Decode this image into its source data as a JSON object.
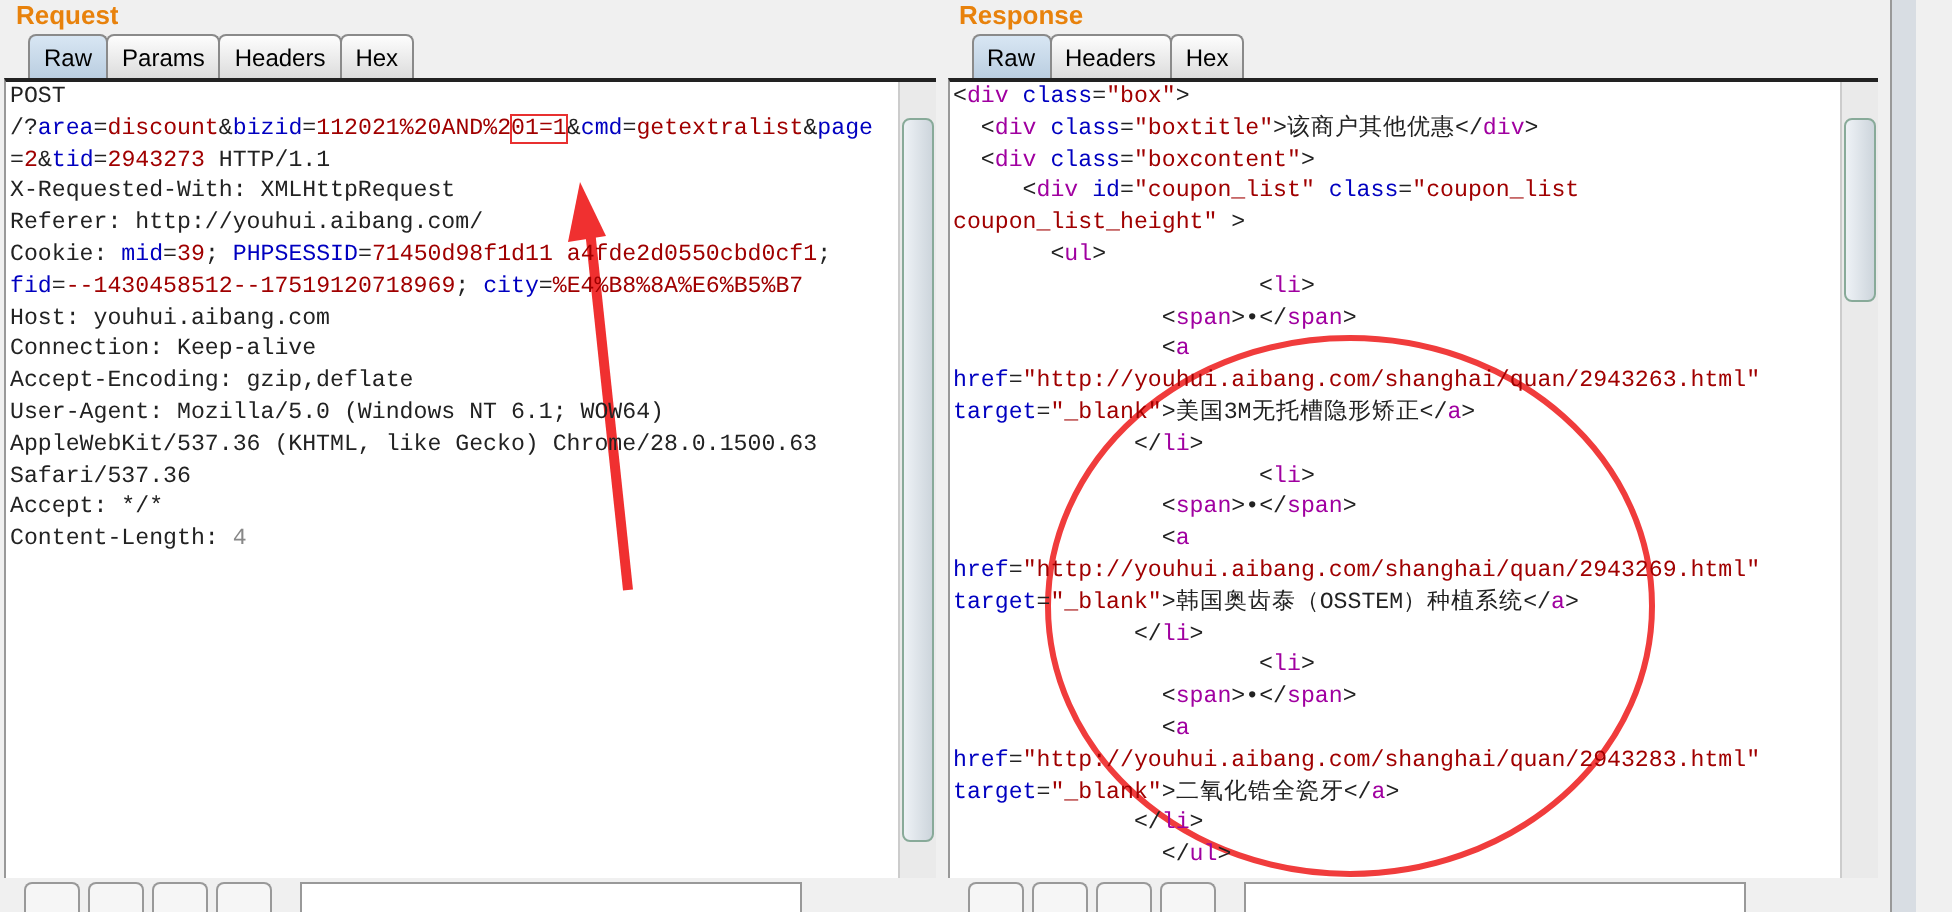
{
  "request": {
    "title": "Request",
    "tabs": [
      {
        "label": "Raw",
        "selected": true
      },
      {
        "label": "Params",
        "selected": false
      },
      {
        "label": "Headers",
        "selected": false
      },
      {
        "label": "Hex",
        "selected": false
      }
    ],
    "lines": [
      [
        {
          "kind": "plain",
          "text": "POST"
        }
      ],
      [
        {
          "kind": "plain",
          "text": "/?"
        },
        {
          "kind": "attr",
          "text": "area"
        },
        {
          "kind": "plain",
          "text": "="
        },
        {
          "kind": "value",
          "text": "discount"
        },
        {
          "kind": "plain",
          "text": "&"
        },
        {
          "kind": "attr",
          "text": "bizid"
        },
        {
          "kind": "plain",
          "text": "="
        },
        {
          "kind": "value",
          "text": "112021%20AND%2"
        },
        {
          "kind": "value",
          "text": "01=1",
          "highlighted": true
        },
        {
          "kind": "plain",
          "text": "&"
        },
        {
          "kind": "attr",
          "text": "cmd"
        },
        {
          "kind": "plain",
          "text": "="
        },
        {
          "kind": "value",
          "text": "getextralist"
        },
        {
          "kind": "plain",
          "text": "&"
        },
        {
          "kind": "attr",
          "text": "page"
        }
      ],
      [
        {
          "kind": "plain",
          "text": "="
        },
        {
          "kind": "value",
          "text": "2"
        },
        {
          "kind": "plain",
          "text": "&"
        },
        {
          "kind": "attr",
          "text": "tid"
        },
        {
          "kind": "plain",
          "text": "="
        },
        {
          "kind": "value",
          "text": "2943273"
        },
        {
          "kind": "plain",
          "text": " HTTP/1.1"
        }
      ],
      [
        {
          "kind": "plain",
          "text": "X-Requested-With: XMLHttpRequest"
        }
      ],
      [
        {
          "kind": "plain",
          "text": "Referer: http://youhui.aibang.com/"
        }
      ],
      [
        {
          "kind": "plain",
          "text": "Cookie: "
        },
        {
          "kind": "attr",
          "text": "mid"
        },
        {
          "kind": "plain",
          "text": "="
        },
        {
          "kind": "value",
          "text": "39"
        },
        {
          "kind": "plain",
          "text": "; "
        },
        {
          "kind": "attr",
          "text": "PHPSESSID"
        },
        {
          "kind": "plain",
          "text": "="
        },
        {
          "kind": "value",
          "text": "71450d98f1d11 a4fde2d0550cbd0cf1"
        },
        {
          "kind": "plain",
          "text": ";"
        }
      ],
      [
        {
          "kind": "attr",
          "text": "fid"
        },
        {
          "kind": "plain",
          "text": "="
        },
        {
          "kind": "value",
          "text": "--1430458512--17519120718969"
        },
        {
          "kind": "plain",
          "text": "; "
        },
        {
          "kind": "attr",
          "text": "city"
        },
        {
          "kind": "plain",
          "text": "="
        },
        {
          "kind": "value",
          "text": "%E4%B8%8A%E6%B5%B7"
        }
      ],
      [
        {
          "kind": "plain",
          "text": "Host: youhui.aibang.com"
        }
      ],
      [
        {
          "kind": "plain",
          "text": "Connection: Keep-alive"
        }
      ],
      [
        {
          "kind": "plain",
          "text": "Accept-Encoding: gzip,deflate"
        }
      ],
      [
        {
          "kind": "plain",
          "text": "User-Agent: Mozilla/5.0 (Windows NT 6.1; WOW64)"
        }
      ],
      [
        {
          "kind": "plain",
          "text": "AppleWebKit/537.36 (KHTML, like Gecko) Chrome/28.0.1500.63"
        }
      ],
      [
        {
          "kind": "plain",
          "text": "Safari/537.36"
        }
      ],
      [
        {
          "kind": "plain",
          "text": "Accept: */*"
        }
      ],
      [
        {
          "kind": "plain",
          "text": "Content-Length: "
        },
        {
          "kind": "dim",
          "text": "4"
        }
      ]
    ]
  },
  "response": {
    "title": "Response",
    "tabs": [
      {
        "label": "Raw",
        "selected": true
      },
      {
        "label": "Headers",
        "selected": false
      },
      {
        "label": "Hex",
        "selected": false
      }
    ],
    "lines": [
      [
        {
          "kind": "plain",
          "text": "<"
        },
        {
          "kind": "tag",
          "text": "div"
        },
        {
          "kind": "attr",
          "text": " class"
        },
        {
          "kind": "plain",
          "text": "="
        },
        {
          "kind": "value",
          "text": "\"box\""
        },
        {
          "kind": "plain",
          "text": ">"
        }
      ],
      [
        {
          "kind": "plain",
          "text": "  <"
        },
        {
          "kind": "tag",
          "text": "div"
        },
        {
          "kind": "attr",
          "text": " class"
        },
        {
          "kind": "plain",
          "text": "="
        },
        {
          "kind": "value",
          "text": "\"boxtitle\""
        },
        {
          "kind": "plain",
          "text": ">该商户其他优惠</"
        },
        {
          "kind": "tag",
          "text": "div"
        },
        {
          "kind": "plain",
          "text": ">"
        }
      ],
      [
        {
          "kind": "plain",
          "text": "  <"
        },
        {
          "kind": "tag",
          "text": "div"
        },
        {
          "kind": "attr",
          "text": " class"
        },
        {
          "kind": "plain",
          "text": "="
        },
        {
          "kind": "value",
          "text": "\"boxcontent\""
        },
        {
          "kind": "plain",
          "text": ">"
        }
      ],
      [
        {
          "kind": "plain",
          "text": "     <"
        },
        {
          "kind": "tag",
          "text": "div"
        },
        {
          "kind": "attr",
          "text": " id"
        },
        {
          "kind": "plain",
          "text": "="
        },
        {
          "kind": "value",
          "text": "\"coupon_list\""
        },
        {
          "kind": "attr",
          "text": " class"
        },
        {
          "kind": "plain",
          "text": "="
        },
        {
          "kind": "value",
          "text": "\"coupon_list"
        }
      ],
      [
        {
          "kind": "value",
          "text": "coupon_list_height\""
        },
        {
          "kind": "plain",
          "text": " >"
        }
      ],
      [
        {
          "kind": "plain",
          "text": "       <"
        },
        {
          "kind": "tag",
          "text": "ul"
        },
        {
          "kind": "plain",
          "text": ">"
        }
      ],
      [
        {
          "kind": "plain",
          "text": "                      <"
        },
        {
          "kind": "tag",
          "text": "li"
        },
        {
          "kind": "plain",
          "text": ">"
        }
      ],
      [
        {
          "kind": "plain",
          "text": "               <"
        },
        {
          "kind": "tag",
          "text": "span"
        },
        {
          "kind": "plain",
          "text": ">•</"
        },
        {
          "kind": "tag",
          "text": "span"
        },
        {
          "kind": "plain",
          "text": ">"
        }
      ],
      [
        {
          "kind": "plain",
          "text": "               <"
        },
        {
          "kind": "tag",
          "text": "a"
        }
      ],
      [
        {
          "kind": "attr",
          "text": "href"
        },
        {
          "kind": "plain",
          "text": "="
        },
        {
          "kind": "value",
          "text": "\"http://youhui.aibang.com/shanghai/quan/2943263.html\""
        }
      ],
      [
        {
          "kind": "attr",
          "text": "target"
        },
        {
          "kind": "plain",
          "text": "="
        },
        {
          "kind": "value",
          "text": "\"_blank\""
        },
        {
          "kind": "plain",
          "text": ">美国3M无托槽隐形矫正</"
        },
        {
          "kind": "tag",
          "text": "a"
        },
        {
          "kind": "plain",
          "text": ">"
        }
      ],
      [
        {
          "kind": "plain",
          "text": "             </"
        },
        {
          "kind": "tag",
          "text": "li"
        },
        {
          "kind": "plain",
          "text": ">"
        }
      ],
      [
        {
          "kind": "plain",
          "text": "                      <"
        },
        {
          "kind": "tag",
          "text": "li"
        },
        {
          "kind": "plain",
          "text": ">"
        }
      ],
      [
        {
          "kind": "plain",
          "text": "               <"
        },
        {
          "kind": "tag",
          "text": "span"
        },
        {
          "kind": "plain",
          "text": ">•</"
        },
        {
          "kind": "tag",
          "text": "span"
        },
        {
          "kind": "plain",
          "text": ">"
        }
      ],
      [
        {
          "kind": "plain",
          "text": "               <"
        },
        {
          "kind": "tag",
          "text": "a"
        }
      ],
      [
        {
          "kind": "attr",
          "text": "href"
        },
        {
          "kind": "plain",
          "text": "="
        },
        {
          "kind": "value",
          "text": "\"http://youhui.aibang.com/shanghai/quan/2943269.html\""
        }
      ],
      [
        {
          "kind": "attr",
          "text": "target"
        },
        {
          "kind": "plain",
          "text": "="
        },
        {
          "kind": "value",
          "text": "\"_blank\""
        },
        {
          "kind": "plain",
          "text": ">韩国奥齿泰（OSSTEM）种植系统</"
        },
        {
          "kind": "tag",
          "text": "a"
        },
        {
          "kind": "plain",
          "text": ">"
        }
      ],
      [
        {
          "kind": "plain",
          "text": "             </"
        },
        {
          "kind": "tag",
          "text": "li"
        },
        {
          "kind": "plain",
          "text": ">"
        }
      ],
      [
        {
          "kind": "plain",
          "text": "                      <"
        },
        {
          "kind": "tag",
          "text": "li"
        },
        {
          "kind": "plain",
          "text": ">"
        }
      ],
      [
        {
          "kind": "plain",
          "text": "               <"
        },
        {
          "kind": "tag",
          "text": "span"
        },
        {
          "kind": "plain",
          "text": ">•</"
        },
        {
          "kind": "tag",
          "text": "span"
        },
        {
          "kind": "plain",
          "text": ">"
        }
      ],
      [
        {
          "kind": "plain",
          "text": "               <"
        },
        {
          "kind": "tag",
          "text": "a"
        }
      ],
      [
        {
          "kind": "attr",
          "text": "href"
        },
        {
          "kind": "plain",
          "text": "="
        },
        {
          "kind": "value",
          "text": "\"http://youhui.aibang.com/shanghai/quan/2943283.html\""
        }
      ],
      [
        {
          "kind": "attr",
          "text": "target"
        },
        {
          "kind": "plain",
          "text": "="
        },
        {
          "kind": "value",
          "text": "\"_blank\""
        },
        {
          "kind": "plain",
          "text": ">二氧化锆全瓷牙</"
        },
        {
          "kind": "tag",
          "text": "a"
        },
        {
          "kind": "plain",
          "text": ">"
        }
      ],
      [
        {
          "kind": "plain",
          "text": "             </"
        },
        {
          "kind": "tag",
          "text": "li"
        },
        {
          "kind": "plain",
          "text": ">"
        }
      ],
      [
        {
          "kind": "plain",
          "text": "               </"
        },
        {
          "kind": "tag",
          "text": "ul"
        },
        {
          "kind": "plain",
          "text": ">"
        }
      ]
    ]
  }
}
